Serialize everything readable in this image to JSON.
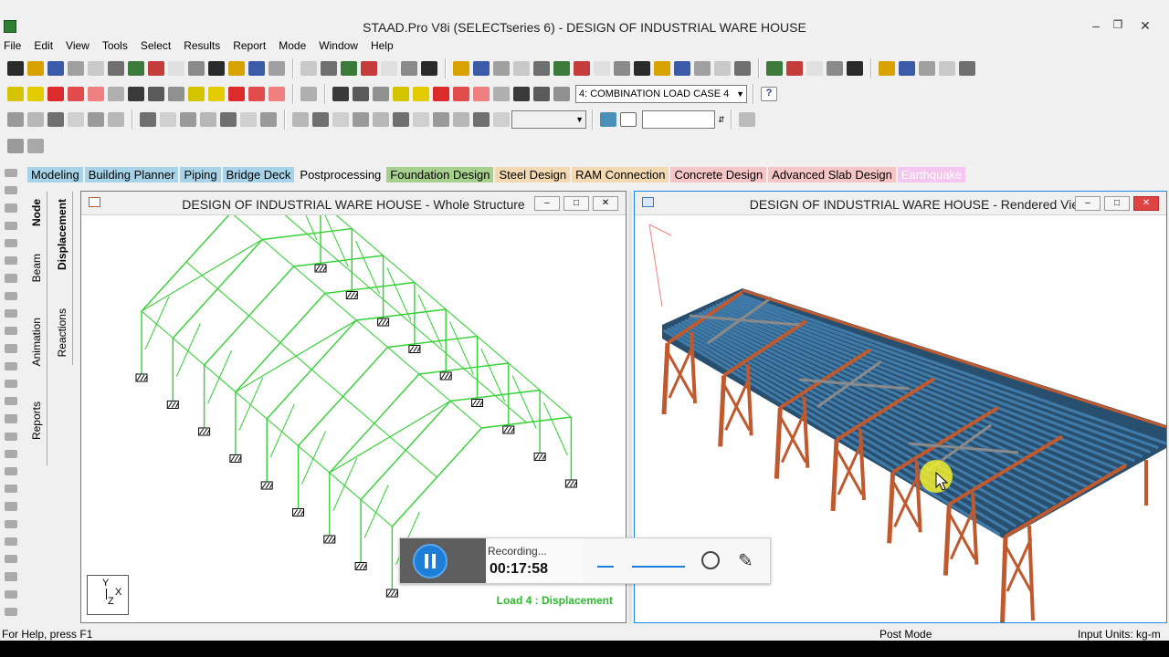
{
  "app": {
    "title": "STAAD.Pro V8i (SELECTseries 6) - DESIGN OF INDUSTRIAL WARE HOUSE"
  },
  "menu": [
    "File",
    "Edit",
    "View",
    "Tools",
    "Select",
    "Results",
    "Report",
    "Mode",
    "Window",
    "Help"
  ],
  "load_case_select": {
    "value": "4: COMBINATION LOAD CASE 4"
  },
  "modes": [
    {
      "label": "Modeling",
      "bg": "#a6d3e8"
    },
    {
      "label": "Building Planner",
      "bg": "#a6d3e8"
    },
    {
      "label": "Piping",
      "bg": "#a6d3e8"
    },
    {
      "label": "Bridge Deck",
      "bg": "#a6d3e8"
    },
    {
      "label": "Postprocessing",
      "bg": "#f0f0f0"
    },
    {
      "label": "Foundation Design",
      "bg": "#a8d08d"
    },
    {
      "label": "Steel Design",
      "bg": "#f3d9b1"
    },
    {
      "label": "RAM Connection",
      "bg": "#f3d9b1"
    },
    {
      "label": "Concrete Design",
      "bg": "#f6c6c6"
    },
    {
      "label": "Advanced Slab Design",
      "bg": "#f6c6c6"
    },
    {
      "label": "Earthquake",
      "bg": "#f6c6f0"
    }
  ],
  "vtabs": {
    "node": "Node",
    "beam": "Beam",
    "animation": "Animation",
    "reports": "Reports",
    "displacement": "Displacement",
    "reactions": "Reactions"
  },
  "window_left": {
    "title": "DESIGN OF INDUSTRIAL WARE HOUSE  - Whole Structure",
    "footer_label": "Load 4 : Displacement",
    "axis": {
      "y": "Y",
      "x": "X",
      "z": "Z"
    }
  },
  "window_right": {
    "title": "DESIGN OF INDUSTRIAL WARE HOUSE  - Rendered View"
  },
  "recorder": {
    "status": "Recording...",
    "time": "00:17:58"
  },
  "status": {
    "help": "For Help, press F1",
    "mode": "Post Mode",
    "units": "Input Units:  kg-m"
  },
  "colors": {
    "wire": "#34d134",
    "purlin": "#2e5f85",
    "frame": "#c0592e",
    "accent": "#1c7ed6"
  }
}
